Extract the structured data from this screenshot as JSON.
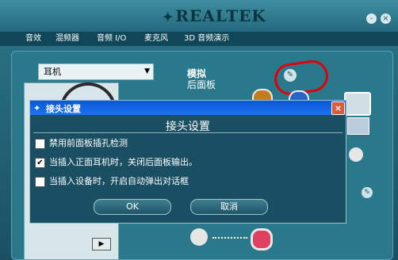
{
  "app": {
    "brand": "REALTEK",
    "minimize": "-",
    "close": "×"
  },
  "tabs": [
    {
      "label": "音效"
    },
    {
      "label": "混频器"
    },
    {
      "label": "音频 I/O"
    },
    {
      "label": "麦克风"
    },
    {
      "label": "3D 音频演示"
    }
  ],
  "device_select": {
    "value": "耳机"
  },
  "panel": {
    "analog_label": "模拟",
    "back_panel_label": "后面板"
  },
  "dialog": {
    "title": "接头设置",
    "heading": "接头设置",
    "close": "×",
    "options": [
      {
        "label": "禁用前面板插孔检测",
        "checked": false
      },
      {
        "label": "当插入正面耳机时，关闭后面板输出。",
        "checked": true
      },
      {
        "label": "当插入设备时，开启自动弹出对话框",
        "checked": false
      }
    ],
    "ok_label": "OK",
    "cancel_label": "取消"
  },
  "colors": {
    "titlebar": "#0a57d6",
    "panel": "#2a788c",
    "annotation": "#e0000a"
  }
}
